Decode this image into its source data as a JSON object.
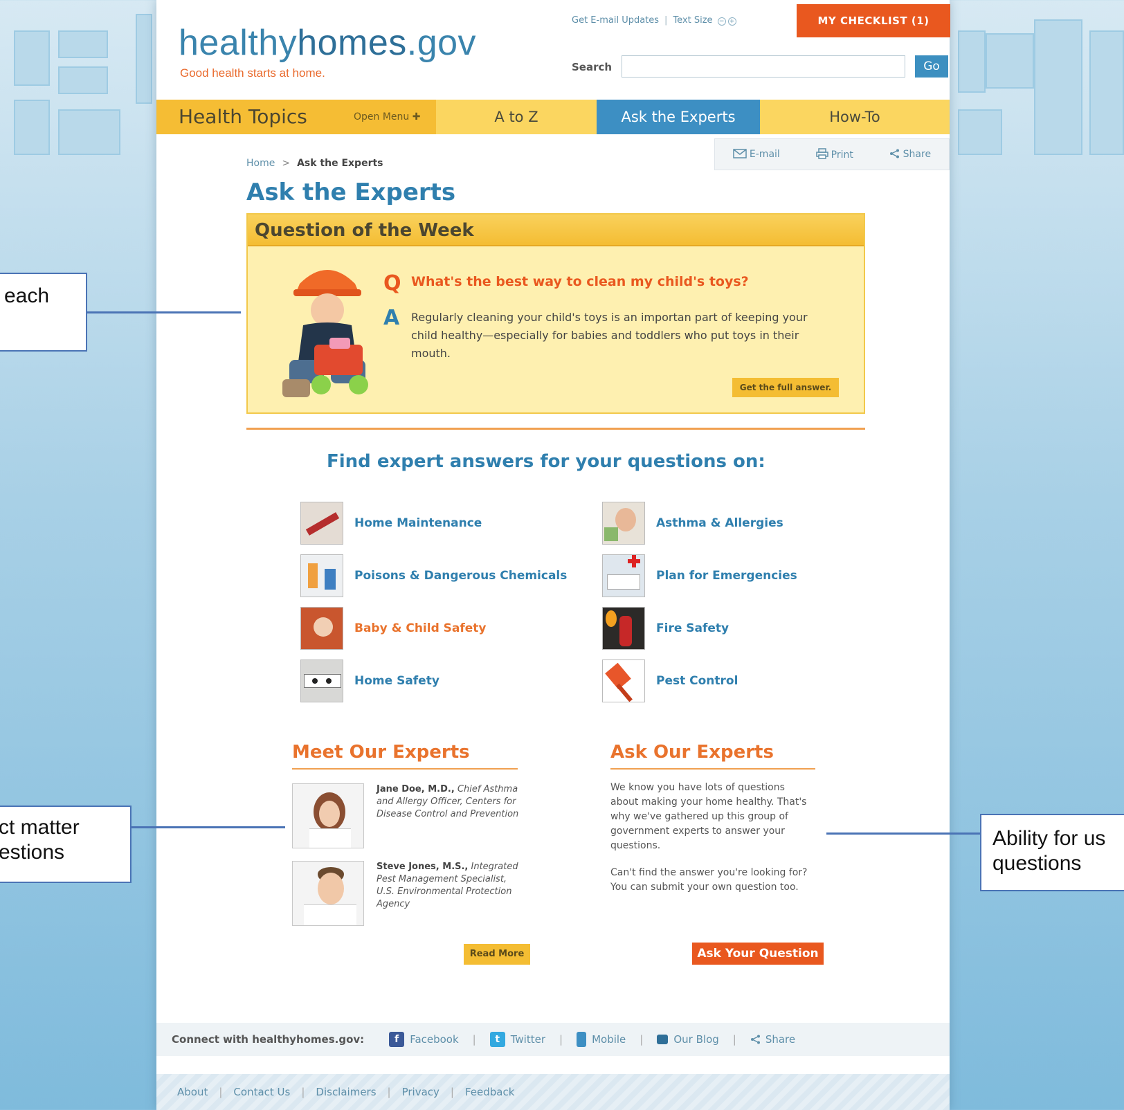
{
  "site": {
    "logo_light": "healthy",
    "logo_bold": "homes",
    "logo_tld": ".gov",
    "tagline": "Good health starts at home."
  },
  "utility": {
    "email_updates": "Get E-mail Updates",
    "text_size": "Text Size",
    "minus": "−",
    "plus": "+",
    "checklist": "MY CHECKLIST (1)",
    "search_label": "Search",
    "search_placeholder": "",
    "go": "Go"
  },
  "nav": {
    "health_topics": "Health Topics",
    "open_menu": "Open Menu ✚",
    "a_to_z": "A to Z",
    "ask_experts": "Ask the Experts",
    "how_to": "How-To"
  },
  "toolbar": {
    "email": "E-mail",
    "print": "Print",
    "share": "Share"
  },
  "breadcrumb": {
    "home": "Home",
    "sep": ">",
    "current": "Ask the Experts"
  },
  "page_title": "Ask the Experts",
  "qotw": {
    "heading": "Question of the Week",
    "q_letter": "Q",
    "question": "What's the best way to clean my child's toys?",
    "a_letter": "A",
    "answer": "Regularly cleaning your child's toys is an importan part of keeping your child healthy—especially for babies and toddlers who put toys in their mouth.",
    "full_answer": "Get the full answer."
  },
  "find_heading": "Find expert answers for your questions on:",
  "topics": [
    {
      "label": "Home Maintenance"
    },
    {
      "label": "Asthma & Allergies"
    },
    {
      "label": "Poisons & Dangerous Chemicals"
    },
    {
      "label": "Plan for Emergencies"
    },
    {
      "label": "Baby & Child Safety"
    },
    {
      "label": "Fire Safety"
    },
    {
      "label": "Home Safety"
    },
    {
      "label": "Pest Control"
    }
  ],
  "meet": {
    "title": "Meet Our Experts",
    "experts": [
      {
        "name": "Jane Doe, M.D.,",
        "title": "Chief Asthma and Allergy Officer, Centers for Disease Control and Prevention"
      },
      {
        "name": "Steve Jones, M.S.,",
        "title": "Integrated Pest Management Specialist, U.S. Environmental Protection Agency"
      }
    ],
    "read_more": "Read More"
  },
  "ask": {
    "title": "Ask Our Experts",
    "p1": "We know you have lots of questions about making your home healthy. That's why we've gathered up this group of government experts to answer your questions.",
    "p2": "Can't find the answer you're looking for? You can submit your own question too.",
    "button": "Ask Your Question"
  },
  "connect": {
    "label": "Connect with healthyhomes.gov:",
    "facebook": "Facebook",
    "twitter": "Twitter",
    "mobile": "Mobile",
    "blog": "Our Blog",
    "share": "Share",
    "sep": "|"
  },
  "footer": {
    "about": "About",
    "contact": "Contact Us",
    "disclaimers": "Disclaimers",
    "privacy": "Privacy",
    "feedback": "Feedback",
    "sep": "|"
  },
  "callouts": {
    "left_top": "each",
    "left_bottom_1": "ct matter",
    "left_bottom_2": "estions",
    "right_1": "Ability for us",
    "right_2": "questions"
  },
  "colors": {
    "brand_blue": "#2f7fae",
    "brand_orange": "#e9581f",
    "nav_yellow": "#f9cf4b",
    "active_tab": "#3d8fc3"
  }
}
